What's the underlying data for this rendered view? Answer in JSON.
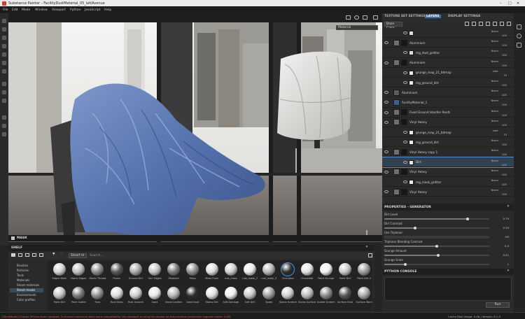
{
  "app": {
    "title": "Substance Painter - FacilityDustMaterial_05_lattAvenue"
  },
  "menu": [
    "File",
    "Edit",
    "Mode",
    "Window",
    "Viewport",
    "Python",
    "JavaScript",
    "Help"
  ],
  "viewport": {
    "dropdown": "Material"
  },
  "tabs": {
    "texture_set": "TEXTURE SET SETTINGS",
    "layers": "LAYERS",
    "display": "DISPLAY SETTINGS"
  },
  "layers_toolbar": {
    "channel": "Base Color"
  },
  "layers": [
    {
      "name": "",
      "type": "mask",
      "blend": "Norm",
      "opacity": "100"
    },
    {
      "name": "Aluminium",
      "type": "fill",
      "blend": "Norm",
      "opacity": "100"
    },
    {
      "name": "mg_dust_grditor",
      "type": "mask",
      "blend": "Norm",
      "opacity": "100"
    },
    {
      "name": "Aluminium",
      "type": "fill",
      "blend": "Norm",
      "opacity": "100"
    },
    {
      "name": "grunge_map_21_bitmap",
      "type": "sub",
      "blend": "Lder",
      "opacity": "75"
    },
    {
      "name": "mg_ground_dirt",
      "type": "sub",
      "blend": "Norm",
      "opacity": "100"
    },
    {
      "name": "Aluminium",
      "type": "plain",
      "blend": "Norm",
      "opacity": "100"
    },
    {
      "name": "FacilityMaterial_1",
      "type": "folder",
      "blend": "Norm",
      "opacity": "100"
    },
    {
      "name": "Fixed Ground Handler Roofs",
      "type": "fill",
      "blend": "Norm",
      "opacity": "100"
    },
    {
      "name": "Vinyl Heavy",
      "type": "fill",
      "blend": "Norm",
      "opacity": "100"
    },
    {
      "name": "grunge_map_21_bitmap",
      "type": "sub",
      "blend": "Lder",
      "opacity": "75"
    },
    {
      "name": "mg_ground_dirt",
      "type": "sub",
      "blend": "Norm",
      "opacity": "100"
    },
    {
      "name": "Vinyl Heavy copy 1",
      "type": "fill",
      "blend": "Norm",
      "opacity": "100"
    },
    {
      "name": "Dirt",
      "type": "sub",
      "blend": "Norm",
      "opacity": "100"
    },
    {
      "name": "Vinyl Heavy",
      "type": "fill",
      "blend": "Norm",
      "opacity": "100"
    },
    {
      "name": "mg_mask_grditor",
      "type": "sub",
      "blend": "Norm",
      "opacity": "100"
    },
    {
      "name": "Vinyl Heavy",
      "type": "fill",
      "blend": "Norm",
      "opacity": "100"
    }
  ],
  "properties": {
    "title": "PROPERTIES - GENERATOR",
    "params": [
      {
        "label": "Dirt Level",
        "value": "0.79",
        "fraction": 0.79
      },
      {
        "label": "Dirt Contrast",
        "value": "0.29",
        "fraction": 0.29
      },
      {
        "label": "Use Triplanar",
        "value": "Off"
      },
      {
        "label": "Triplanar Blending Contrast",
        "value": "0.5",
        "fraction": 0.5
      },
      {
        "label": "Grunge Amount",
        "value": "0.51",
        "fraction": 0.51
      },
      {
        "label": "Grunge Scale",
        "value": "1",
        "fraction": 0.2
      }
    ]
  },
  "python_console": {
    "title": "PYTHON CONSOLE",
    "run_label": "Run"
  },
  "mask_bar": {
    "label": "MASK"
  },
  "shelf": {
    "title": "SHELF",
    "search_placeholder": "Search...",
    "filter_tag": "Smart m",
    "categories": [
      "Brushes",
      "Particles",
      "Tools",
      "Materials",
      "Smart materials",
      "Smart masks",
      "Environments",
      "Color profiles"
    ],
    "active_category": "Smart masks",
    "row1": [
      "Edges Worn",
      "Fabric Edges",
      "Fabric Thread",
      "Floors",
      "Ground Dirt",
      "Gen Edges",
      "Moisture",
      "Moss",
      "Moss From",
      "rust_mask",
      "rust_mask_2",
      "rust_mask_3",
      "Occlusion",
      "Chocolate",
      "Paint Grunge",
      "Paint Dirt",
      "Paint Dirt 2"
    ],
    "row2": [
      "Paint Dirt",
      "Paint Subtle",
      "Rust",
      "Rust Drips",
      "Rust Ground",
      "Sand",
      "Sand Cavities",
      "Sand Dust",
      "Stains Dirt",
      "Soft Damage",
      "Soft Dirt",
      "Spots",
      "Stains Scratch",
      "Stains Surface",
      "Subtle Scratch",
      "Surface Rust",
      "Surface Worn"
    ],
    "ball_colors": [
      "#d0d0d0",
      "#bcbcbc",
      "#8a8a8a",
      "#575757",
      "#a8a8a8",
      "#c4c4c4",
      "#7b7b7b",
      "#8f8f8f",
      "#dddddd",
      "#cfcfcf",
      "#e8e8e8",
      "#b6b6b6",
      "#2e2e2e",
      "#e2e2e2",
      "#f0f0f0",
      "#c8c8c8",
      "#9c9c9c"
    ]
  },
  "status": {
    "message": "[ShelfModel] Shader API has been updated. To ensure maximum back-ward compatibility, the viewport is using the shader as they existed (automatic upgrade made: 0.16)",
    "memory": "Cache Disk Usage: 0.0b | Version: 8.1.2"
  },
  "colors": {
    "accent": "#4a90d9",
    "selection": "#3a4a5c",
    "error_text": "#e25a3a"
  }
}
